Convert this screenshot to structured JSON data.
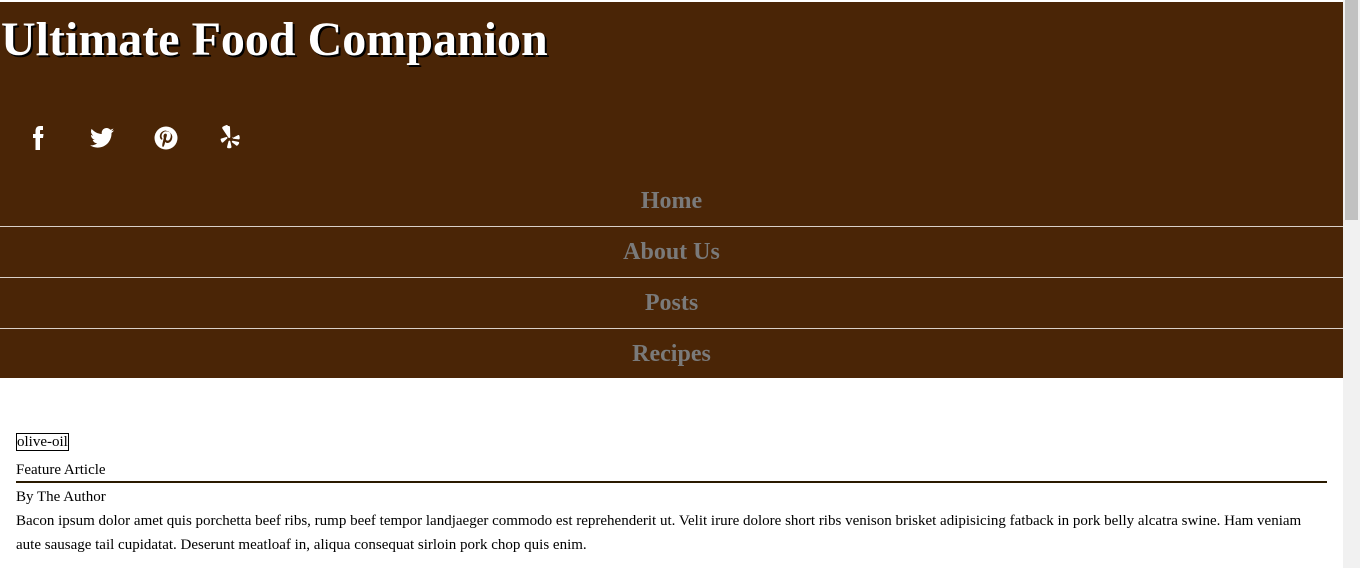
{
  "header": {
    "site_title": "Ultimate Food Companion"
  },
  "social": [
    {
      "name": "facebook",
      "icon": "facebook-icon"
    },
    {
      "name": "twitter",
      "icon": "twitter-icon"
    },
    {
      "name": "pinterest",
      "icon": "pinterest-icon"
    },
    {
      "name": "yelp",
      "icon": "yelp-icon"
    }
  ],
  "nav": {
    "items": [
      {
        "label": "Home"
      },
      {
        "label": "About Us"
      },
      {
        "label": "Posts"
      },
      {
        "label": "Recipes"
      }
    ]
  },
  "article": {
    "image_alt": "olive-oil",
    "kicker": "Feature Article",
    "byline": "By The Author",
    "excerpt": "Bacon ipsum dolor amet quis porchetta beef ribs, rump beef tempor landjaeger commodo est reprehenderit ut. Velit irure dolore short ribs venison brisket adipisicing fatback in pork belly alcatra swine. Ham veniam aute sausage tail cupidatat. Deserunt meatloaf in, aliqua consequat sirloin pork chop quis enim."
  },
  "colors": {
    "header_bg": "#4a2506",
    "nav_text": "#7a7a7a",
    "title_text": "#ffffff"
  }
}
